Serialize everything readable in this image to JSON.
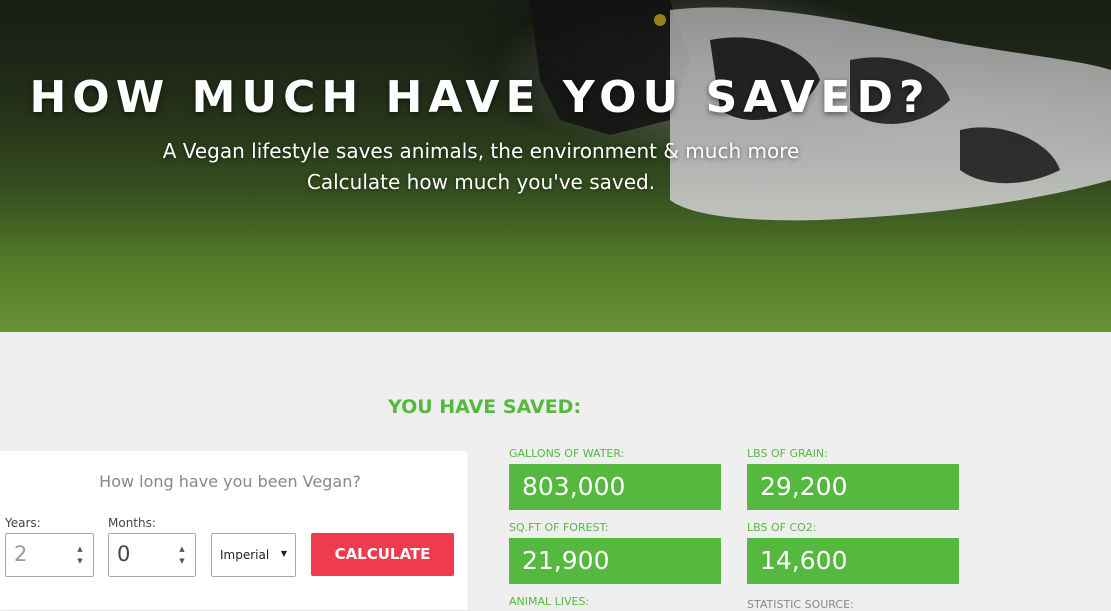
{
  "hero": {
    "title": "HOW MUCH HAVE YOU SAVED?",
    "subtitle_line1": "A Vegan lifestyle saves animals, the environment & much more",
    "subtitle_line2": "Calculate how much you've saved."
  },
  "results": {
    "heading": "YOU HAVE SAVED:",
    "stats": [
      {
        "label": "GALLONS OF WATER:",
        "value": "803,000"
      },
      {
        "label": "LBS OF GRAIN:",
        "value": "29,200"
      },
      {
        "label": "SQ.FT OF FOREST:",
        "value": "21,900"
      },
      {
        "label": "LBS OF CO2:",
        "value": "14,600"
      },
      {
        "label": "ANIMAL LIVES:",
        "value": ""
      }
    ],
    "source_label": "STATISTIC SOURCE:"
  },
  "form": {
    "question": "How long have you been Vegan?",
    "years_label": "Years:",
    "years_value": "2",
    "months_label": "Months:",
    "months_value": "0",
    "unit_selected": "Imperial",
    "calculate_label": "CALCULATE"
  },
  "colors": {
    "accent_green": "#55b93f",
    "button_red": "#ef3b4e"
  }
}
